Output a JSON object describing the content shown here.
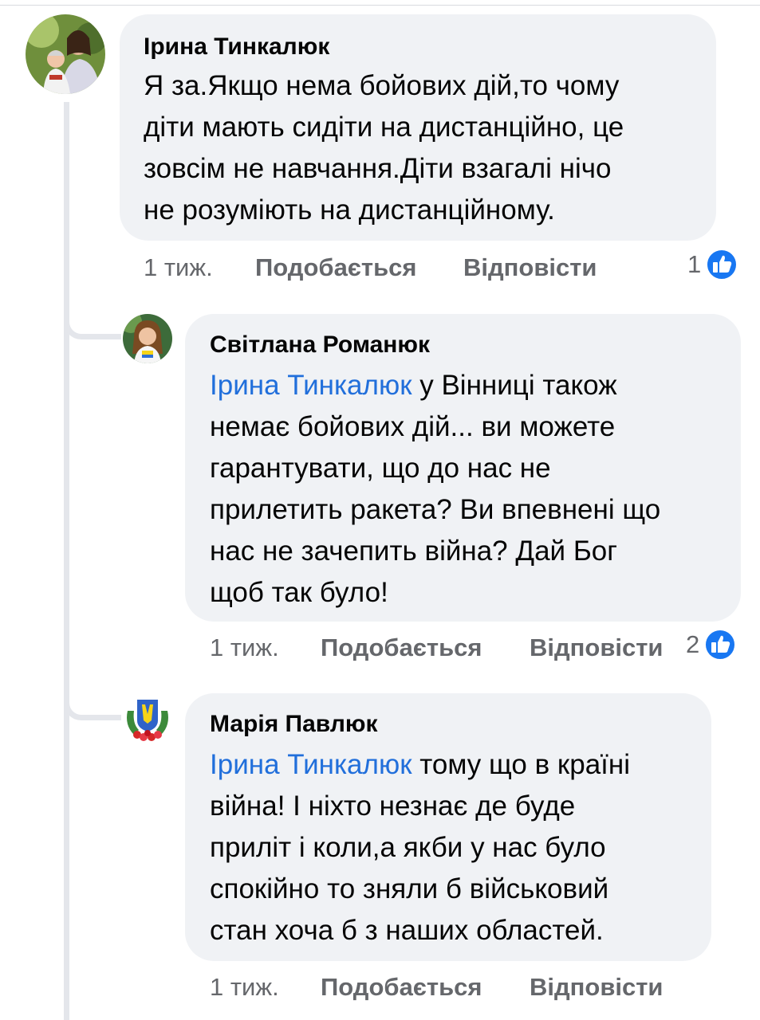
{
  "colors": {
    "mention": "#216fdb",
    "bubble": "#f0f2f5",
    "meta": "#65676b",
    "like": "#1877f2"
  },
  "comments": [
    {
      "author": "Ірина Тинкалюк",
      "lines": [
        "Я за.Якщо нема бойових дій,то чому",
        "діти мають сидіти на дистанційно, це",
        "зовсім не навчання.Діти взагалі нічо",
        "не розуміють на дистанційному."
      ],
      "time": "1 тиж.",
      "like_label": "Подобається",
      "reply_label": "Відповісти",
      "reactions": "1",
      "reaction_icon": "like-icon"
    },
    {
      "author": "Світлана Романюк",
      "mention": "Ірина Тинкалюк",
      "lines": [
        " у Вінниці також",
        "немає бойових дій... ви можете",
        "гарантувати, що до нас не",
        "прилетить ракета? Ви впевнені що",
        "нас не зачепить війна? Дай Бог",
        "щоб так було!"
      ],
      "time": "1 тиж.",
      "like_label": "Подобається",
      "reply_label": "Відповісти",
      "reactions": "2",
      "reaction_icon": "like-icon"
    },
    {
      "author": "Марія Павлюк",
      "mention": "Ірина Тинкалюк",
      "lines": [
        " тому що в країні",
        "війна! І ніхто незнає де буде",
        "приліт і коли,а якби у нас було",
        "спокійно то зняли б військовий",
        "стан хоча б з наших областей."
      ],
      "time": "1 тиж.",
      "like_label": "Подобається",
      "reply_label": "Відповісти"
    }
  ]
}
